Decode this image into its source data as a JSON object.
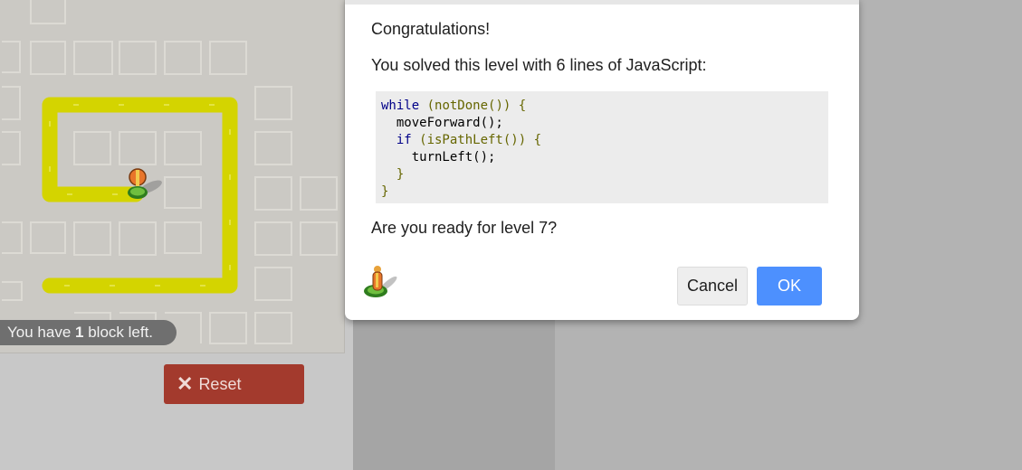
{
  "maze": {
    "blocks_left_prefix": "You have",
    "blocks_left_count": "1",
    "blocks_left_suffix": "block left.",
    "reset_label": "Reset",
    "reset_icon": "close-icon"
  },
  "dialog": {
    "congrats": "Congratulations!",
    "solved": "You solved this level with 6 lines of JavaScript:",
    "code": {
      "line1_kw": "while",
      "line1_rest": " (notDone()) {",
      "line2": "  moveForward();",
      "line3_kw": "  if",
      "line3_rest": " (isPathLeft()) {",
      "line4": "    turnLeft();",
      "line5": "  }",
      "line6": "}"
    },
    "ready": "Are you ready for level 7?",
    "cancel_label": "Cancel",
    "ok_label": "OK",
    "icon": "pegman-icon"
  },
  "colors": {
    "path": "#d4d400",
    "ok_button": "#4d90fe",
    "reset_button": "#a33a2d"
  }
}
